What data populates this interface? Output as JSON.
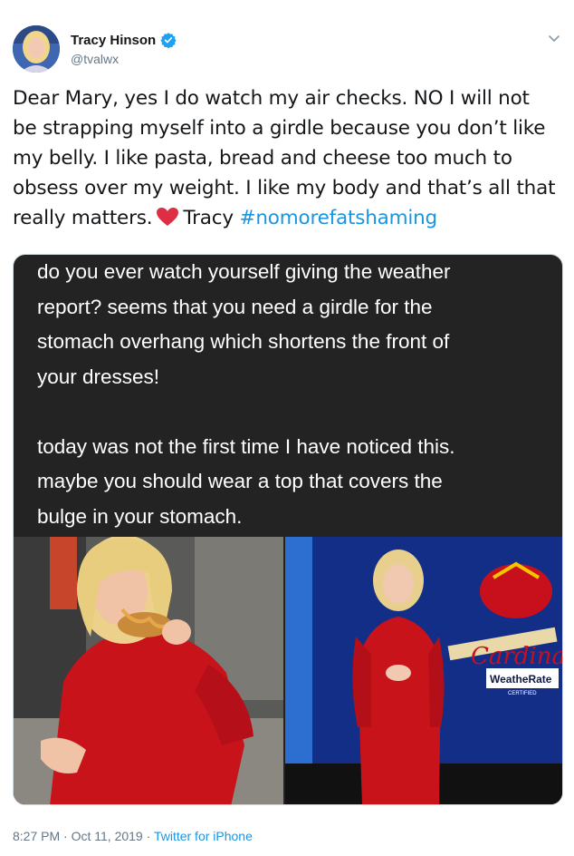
{
  "author": {
    "display_name": "Tracy Hinson",
    "handle": "@tvalwx",
    "verified": true
  },
  "tweet": {
    "text_lines": [
      "Dear Mary, yes I do watch my air checks. NO I will not",
      "be strapping myself into a girdle because you don’t like",
      "my belly. I like pasta, bread and cheese too much to",
      "obsess over my weight. I like my body and that’s all that",
      "really matters."
    ],
    "signature": "Tracy",
    "hashtag": "#nomorefatshaming"
  },
  "media": {
    "message_paragraph_1": [
      "do you ever watch yourself giving the weather",
      "report? seems that you need a girdle for the",
      "stomach overhang which shortens the front of",
      "your dresses!"
    ],
    "message_paragraph_2": [
      "today was not the first time I have noticed this.",
      "maybe you should wear a top that covers the",
      "bulge in your stomach."
    ],
    "tv_logo_text": "Cardinals",
    "tv_badge_text": "WeatheRate",
    "tv_badge_subtext": "CERTIFIED"
  },
  "meta": {
    "time": "8:27 PM",
    "separator": "·",
    "date": "Oct 11, 2019",
    "source": "Twitter for iPhone"
  },
  "colors": {
    "link": "#1b95e0",
    "secondary_text": "#657786",
    "heart": "#e0245e",
    "verified": "#1da1f2"
  },
  "icons": [
    "verified-icon",
    "chevron-down-icon",
    "heart-icon"
  ]
}
